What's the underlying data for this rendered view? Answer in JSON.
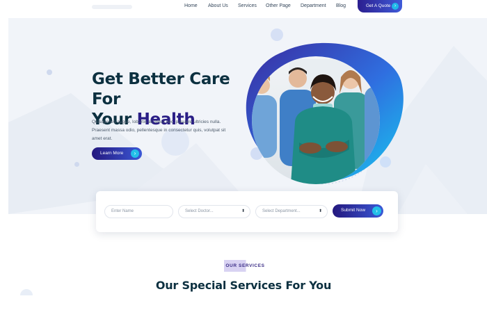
{
  "nav": {
    "links": [
      "Home",
      "About Us",
      "Services",
      "Other Page",
      "Department",
      "Blog"
    ],
    "cta_label": "Get A Quote",
    "cta_icon": "arrow-right-icon"
  },
  "hero": {
    "title_line1": "Get Better Care For",
    "title_line2_plain": "Your ",
    "title_line2_accent": "Health",
    "description": "Quisque leo augue, lobortis ac tellus nec, posuere ultricies nulla. Praesent massa odio, pellentesque in consectetur quis, volutpat sit amet erat.",
    "button_label": "Learn More",
    "button_icon": "arrow-right-icon"
  },
  "booking": {
    "name_placeholder": "Enter Name",
    "doctor_select": "Select Doctor...",
    "department_select": "Select Department...",
    "submit_label": "Submit Now"
  },
  "services": {
    "badge": "OUR SERVICES",
    "title": "Our Special Services For You"
  },
  "colors": {
    "brand_navy": "#24187e",
    "brand_blue": "#3b58d6",
    "accent_cyan": "#23bfe8",
    "heading": "#0c3040",
    "hero_bg": "#f1f4f9"
  }
}
